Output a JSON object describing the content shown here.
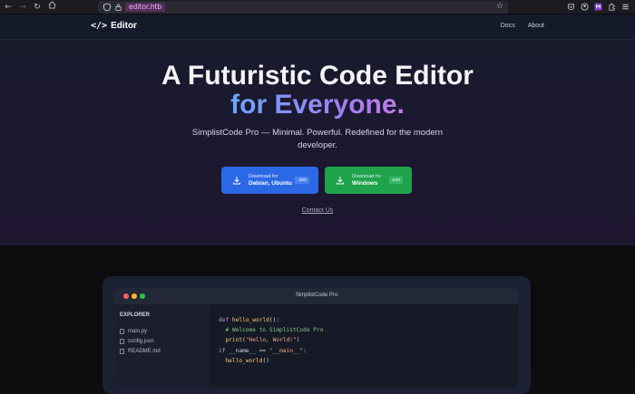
{
  "browser": {
    "url": "editor.htb",
    "icons": [
      "back-icon",
      "forward-icon",
      "reload-icon",
      "home-icon",
      "shield-icon",
      "lock-icon",
      "star-icon",
      "pocket-icon",
      "account-icon",
      "extensions-icon",
      "menu-icon"
    ]
  },
  "nav": {
    "brand_icon": "</>",
    "brand": "Editor",
    "links": [
      "Docs",
      "About"
    ]
  },
  "hero": {
    "headline_line1": "A Futuristic Code Editor",
    "headline_line2": "for Everyone.",
    "subtext": "SimplistCode Pro — Minimal. Powerful. Redefined for the modern developer.",
    "download_deb": {
      "small": "Download for",
      "big": "Debian, Ubuntu",
      "badge": ".deb",
      "color": "#2b68e6"
    },
    "download_win": {
      "small": "Download for",
      "big": "Windows",
      "badge": ".exe",
      "color": "#1ea24a"
    },
    "contact": "Contact Us"
  },
  "preview": {
    "window_title": "SimplistCode Pro",
    "explorer_title": "EXPLORER",
    "files": [
      "main.py",
      "config.json",
      "README.md"
    ],
    "code": {
      "l1_kw": "def",
      "l1_fn": "hello_world",
      "l1_rest": "():",
      "l2": "# Welcome to SimplistCode Pro",
      "l3_fn": "print",
      "l3_open": "(",
      "l3_str": "\"Hello, World!\"",
      "l3_close": ")",
      "l4_kw": "if",
      "l4_mid": " __name__ == ",
      "l4_str": "\"__main__\"",
      "l4_end": ":",
      "l5_fn": "hello_world",
      "l5_rest": "()"
    }
  }
}
